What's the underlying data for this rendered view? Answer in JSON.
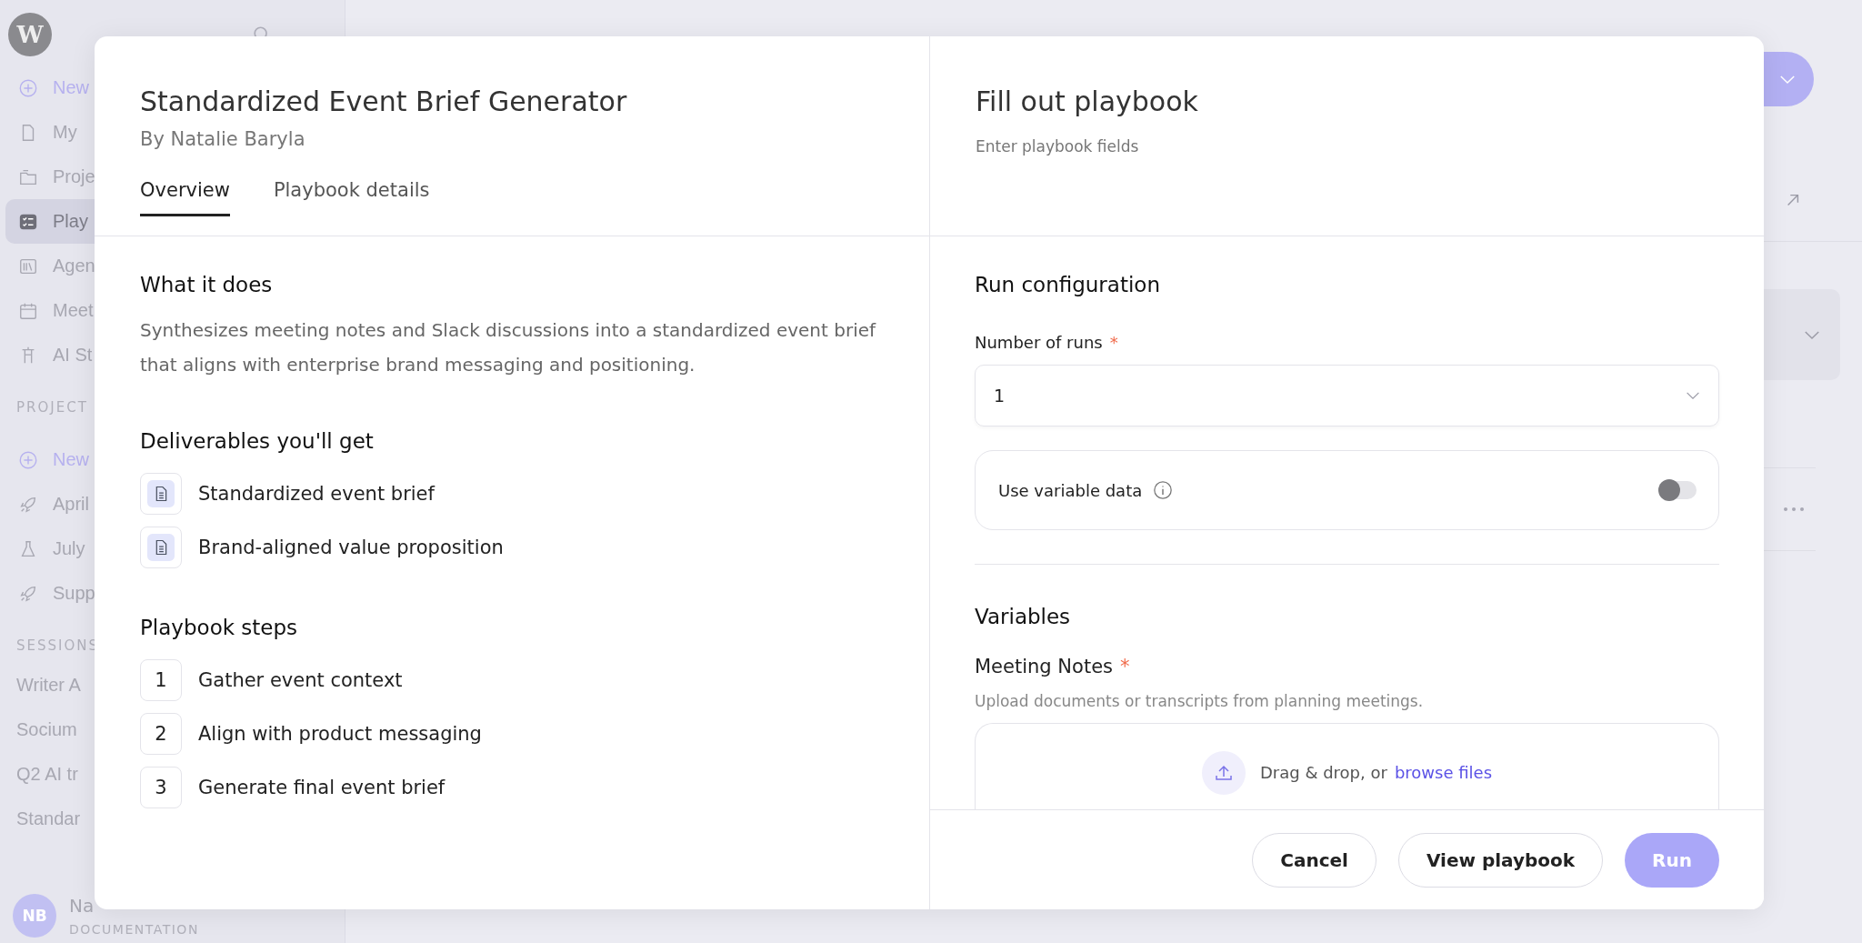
{
  "sidebar": {
    "logo": "W",
    "nav": [
      {
        "label": "New",
        "kind": "new",
        "selected": false
      },
      {
        "label": "My",
        "kind": "doc",
        "selected": false
      },
      {
        "label": "Proje",
        "kind": "folder",
        "selected": false
      },
      {
        "label": "Play",
        "kind": "playbook",
        "selected": true
      },
      {
        "label": "Agen",
        "kind": "library",
        "selected": false
      },
      {
        "label": "Meet",
        "kind": "calendar",
        "selected": false
      },
      {
        "label": "AI St",
        "kind": "studio",
        "selected": false
      }
    ],
    "projects_label": "PROJECT",
    "projects": [
      {
        "label": "New",
        "kind": "new"
      },
      {
        "label": "April",
        "kind": "rocket"
      },
      {
        "label": "July",
        "kind": "flask"
      },
      {
        "label": "Supp",
        "kind": "rocket"
      }
    ],
    "sessions_label": "SESSIONS",
    "sessions": [
      "Writer A",
      "Socium",
      "Q2 AI tr",
      "Standar"
    ],
    "user": {
      "initials": "NB",
      "name": "Na",
      "subtitle": "DOCUMENTATION"
    }
  },
  "modal": {
    "title": "Standardized Event Brief Generator",
    "author": "By Natalie Baryla",
    "tabs": [
      {
        "label": "Overview",
        "selected": true
      },
      {
        "label": "Playbook details",
        "selected": false
      }
    ],
    "what_it_does": {
      "heading": "What it does",
      "text": "Synthesizes meeting notes and Slack discussions into a standardized event brief that aligns with enterprise brand messaging and positioning."
    },
    "deliverables": {
      "heading": "Deliverables you'll get",
      "items": [
        "Standardized event brief",
        "Brand-aligned value proposition"
      ]
    },
    "steps": {
      "heading": "Playbook steps",
      "items": [
        {
          "number": "1",
          "label": "Gather event context"
        },
        {
          "number": "2",
          "label": "Align with product messaging"
        },
        {
          "number": "3",
          "label": "Generate final event brief"
        }
      ]
    },
    "form": {
      "title": "Fill out playbook",
      "subtitle": "Enter playbook fields",
      "run_configuration": {
        "heading": "Run configuration",
        "runs_label": "Number of runs",
        "runs_required_mark": "*",
        "runs_value": "1",
        "variable_data": {
          "label": "Use variable data",
          "on": false
        }
      },
      "variables": {
        "heading": "Variables",
        "fields": [
          {
            "label": "Meeting Notes",
            "required_mark": "*",
            "hint": "Upload documents or transcripts from planning meetings.",
            "drop_text": "Drag & drop, or",
            "browse_link": "browse files"
          }
        ]
      }
    },
    "buttons": [
      {
        "label": "Cancel",
        "kind": "secondary"
      },
      {
        "label": "View playbook",
        "kind": "secondary"
      },
      {
        "label": "Run",
        "kind": "primary",
        "disabled": true
      }
    ]
  }
}
